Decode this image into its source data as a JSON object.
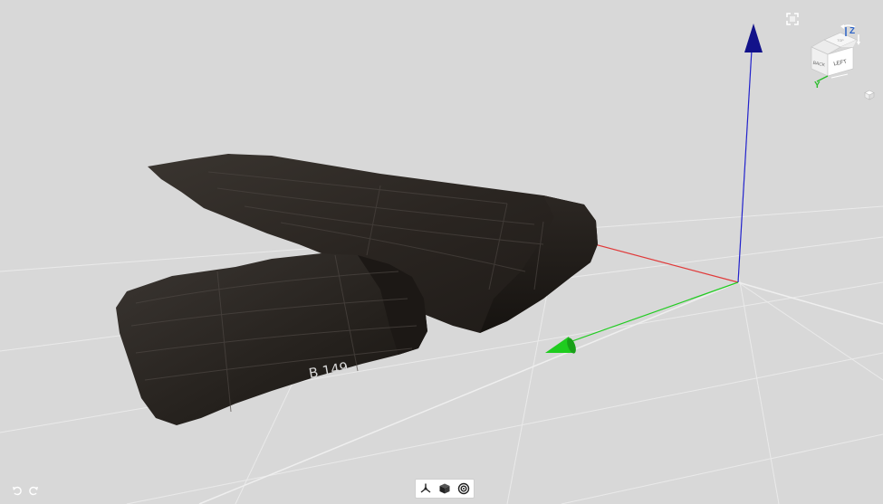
{
  "viewer": {
    "background": "#d8d8d8",
    "axis_colors": {
      "x": "#e03a3a",
      "y": "#22cc22",
      "z": "#1a1ab0"
    }
  },
  "artifact": {
    "inscription": "B 149"
  },
  "viewcube": {
    "faces": {
      "front": "LEFT",
      "side": "BACK",
      "top": "TOP"
    },
    "axis_labels": {
      "z": "Z",
      "y": "Y"
    }
  },
  "icons": {
    "fullscreen": "fullscreen-icon",
    "cube_menu": "small-cube-icon",
    "axes": "axes-icon",
    "solid": "solid-cube-icon",
    "orbit": "orbit-icon",
    "undo": "undo-icon",
    "redo": "redo-icon"
  }
}
